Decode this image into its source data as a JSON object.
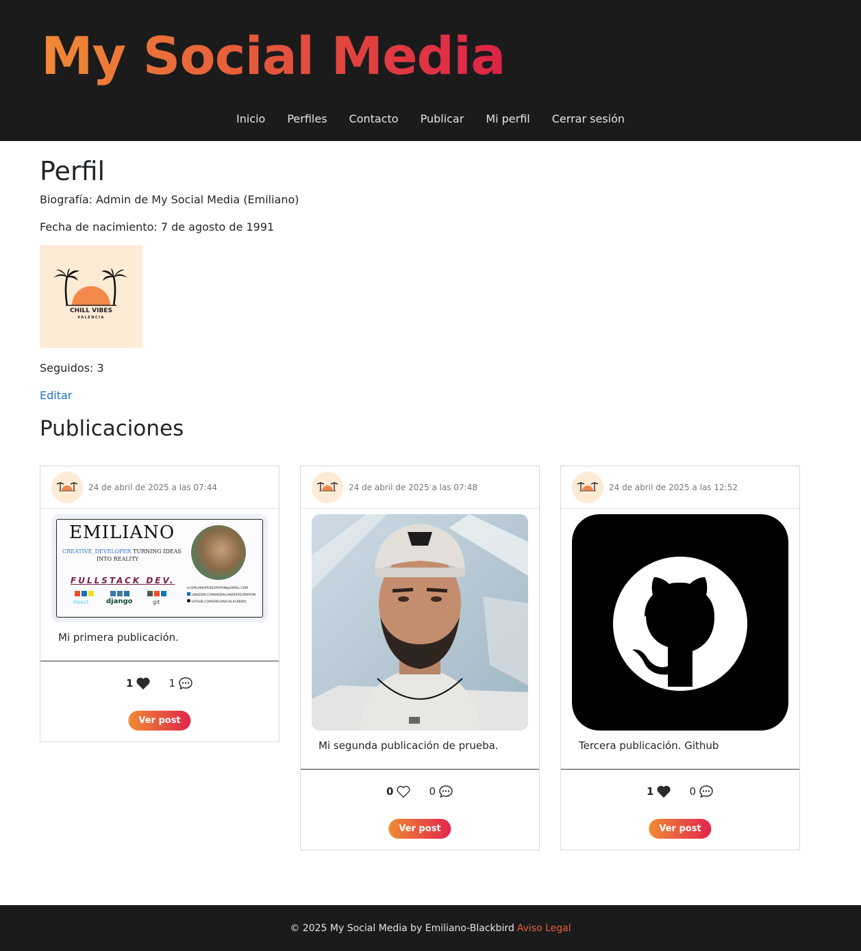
{
  "header": {
    "site_title": "My Social Media",
    "nav": [
      "Inicio",
      "Perfiles",
      "Contacto",
      "Publicar",
      "Mi perfil",
      "Cerrar sesión"
    ]
  },
  "profile": {
    "title": "Perfil",
    "bio": "Biografía: Admin de My Social Media (Emiliano)",
    "birth": "Fecha de nacimiento: 7 de agosto de 1991",
    "logo_text": "CHILL VIBES",
    "logo_subtext": "VALENCIA",
    "following": "Seguidos: 3",
    "edit": "Editar"
  },
  "posts_title": "Publicaciones",
  "posts": [
    {
      "date": "24 de abril de 2025 a las 07:44",
      "text": "Mi primera publicación.",
      "likes": "1",
      "liked": true,
      "comments": "1",
      "button": "Ver post",
      "card": {
        "name": "EMILIANO",
        "tag_a": "CREATIVE_DEVELOPER",
        "tag_b": "TURNING IDEAS",
        "tag_c": "INTO REALITY",
        "role": "FULLSTACK DEV.",
        "skill_a": "React",
        "skill_b": "django",
        "skill_c": "git",
        "email": "EMILIANOPEREZPAPONI@GMAIL.COM",
        "linkedin": "LINKEDIN.COM/IN/EMILIANOPEREZPAPONI",
        "github": "GITHUB.COM/EMILIANO-BLACKBIRD"
      }
    },
    {
      "date": "24 de abril de 2025 a las 07:48",
      "text": "Mi segunda publicación de prueba.",
      "likes": "0",
      "liked": false,
      "comments": "0",
      "button": "Ver post"
    },
    {
      "date": "24 de abril de 2025 a las 12:52",
      "text": "Tercera publicación. Github",
      "likes": "1",
      "liked": true,
      "comments": "0",
      "button": "Ver post"
    }
  ],
  "footer": {
    "copyright": "© 2025 My Social Media by Emiliano-Blackbird",
    "legal": "Aviso Legal"
  },
  "colors": {
    "header_bg": "#1b1b1b",
    "accent_start": "#f08a35",
    "accent_end": "#e0264a",
    "link": "#1a73c8"
  }
}
